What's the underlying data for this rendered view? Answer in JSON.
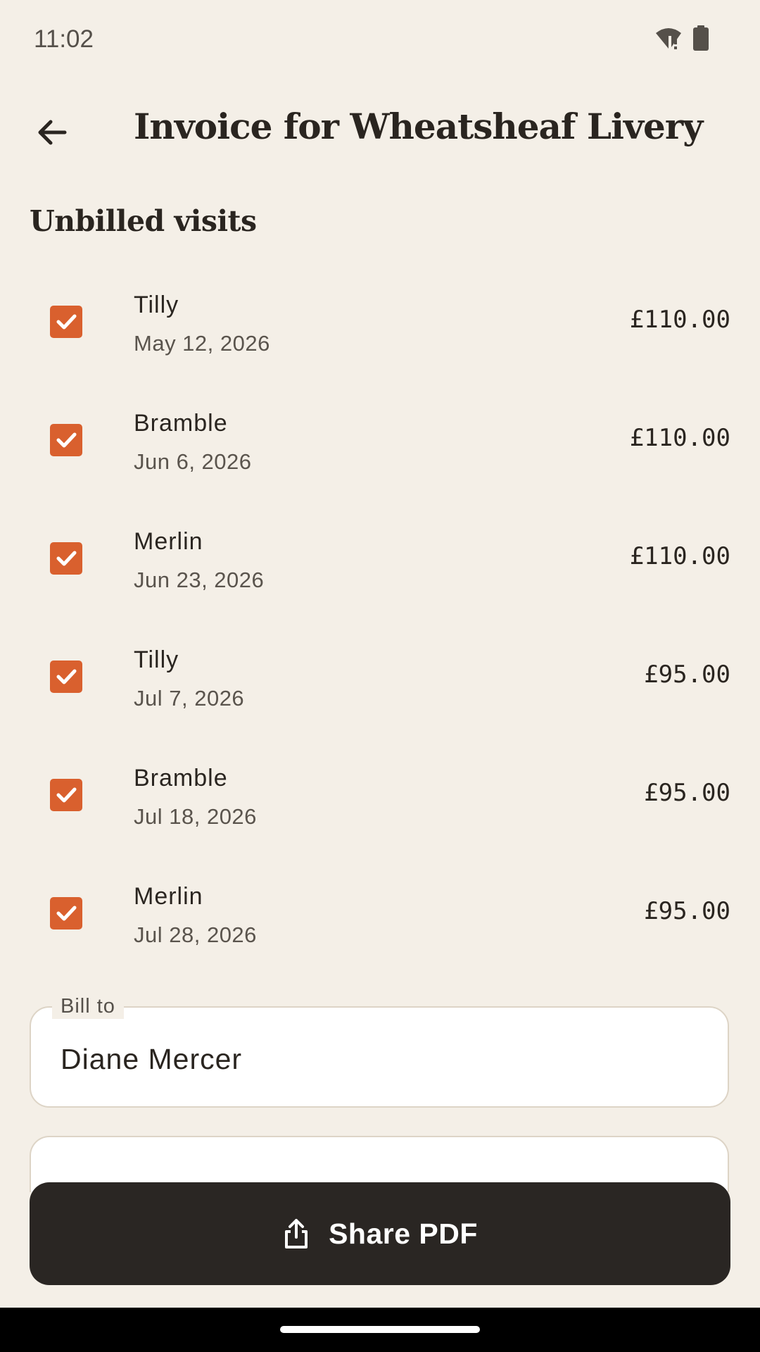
{
  "status_bar": {
    "time": "11:02",
    "icons": [
      "wifi-alert-icon",
      "battery-icon"
    ]
  },
  "header": {
    "back_icon": "arrow-left-icon",
    "title": "Invoice for Wheatsheaf Livery"
  },
  "section": {
    "heading": "Unbilled visits"
  },
  "visits": [
    {
      "name": "Tilly",
      "date": "May 12, 2026",
      "amount": "£110.00",
      "checked": true
    },
    {
      "name": "Bramble",
      "date": "Jun 6, 2026",
      "amount": "£110.00",
      "checked": true
    },
    {
      "name": "Merlin",
      "date": "Jun 23, 2026",
      "amount": "£110.00",
      "checked": true
    },
    {
      "name": "Tilly",
      "date": "Jul 7, 2026",
      "amount": "£95.00",
      "checked": true
    },
    {
      "name": "Bramble",
      "date": "Jul 18, 2026",
      "amount": "£95.00",
      "checked": true
    },
    {
      "name": "Merlin",
      "date": "Jul 28, 2026",
      "amount": "£95.00",
      "checked": true
    }
  ],
  "bill_to": {
    "label": "Bill to",
    "value": "Diane Mercer"
  },
  "share_button": {
    "label": "Share PDF",
    "icon": "share-icon"
  },
  "colors": {
    "background": "#f4efe7",
    "accent": "#d9602e",
    "button": "#2a2623",
    "text": "#2a2520"
  }
}
